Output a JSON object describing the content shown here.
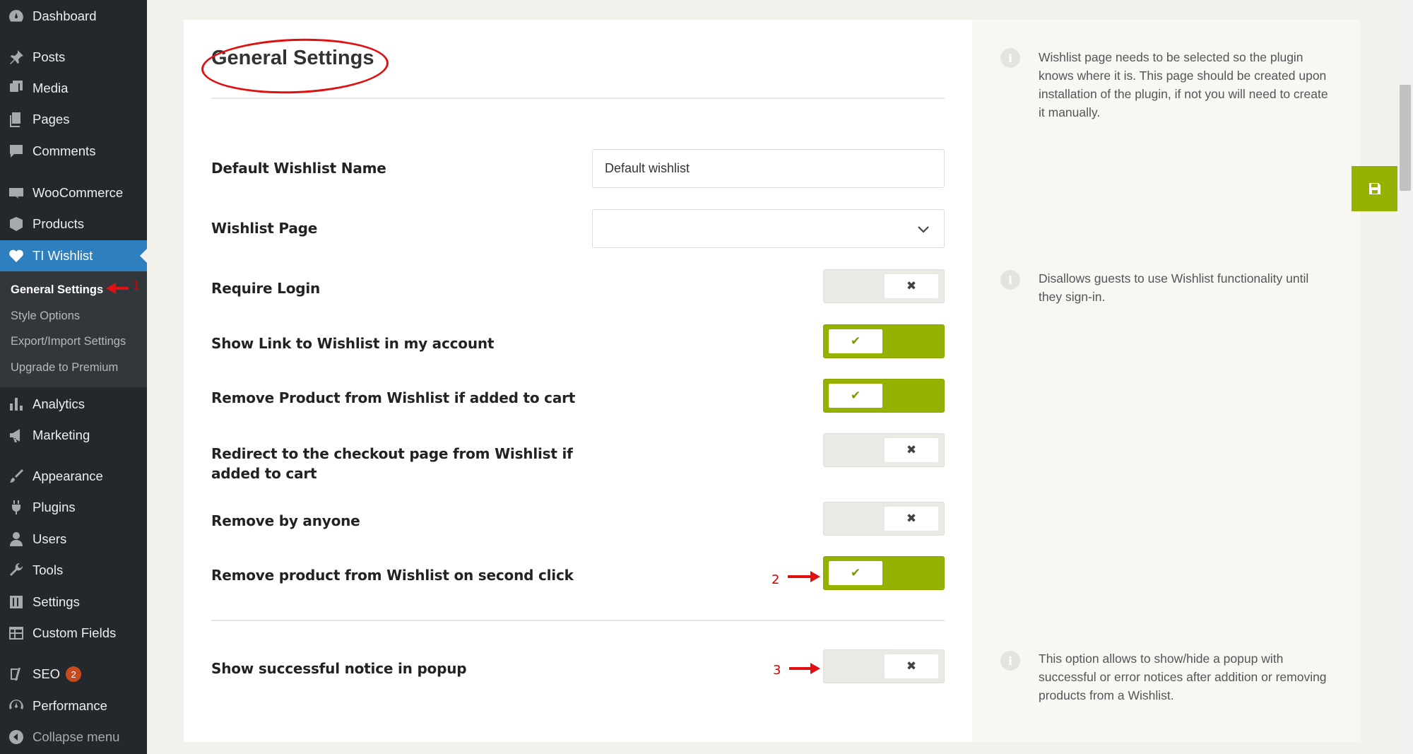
{
  "sidebar": {
    "items": [
      {
        "label": "Dashboard",
        "icon": "dashboard-icon"
      },
      {
        "label": "Posts",
        "icon": "pin-icon"
      },
      {
        "label": "Media",
        "icon": "media-icon"
      },
      {
        "label": "Pages",
        "icon": "pages-icon"
      },
      {
        "label": "Comments",
        "icon": "comment-icon"
      },
      {
        "label": "WooCommerce",
        "icon": "woo-icon"
      },
      {
        "label": "Products",
        "icon": "box-icon"
      },
      {
        "label": "TI Wishlist",
        "icon": "heart-icon"
      },
      {
        "label": "Analytics",
        "icon": "bar-chart-icon"
      },
      {
        "label": "Marketing",
        "icon": "megaphone-icon"
      },
      {
        "label": "Appearance",
        "icon": "brush-icon"
      },
      {
        "label": "Plugins",
        "icon": "plug-icon"
      },
      {
        "label": "Users",
        "icon": "user-icon"
      },
      {
        "label": "Tools",
        "icon": "wrench-icon"
      },
      {
        "label": "Settings",
        "icon": "sliders-icon"
      },
      {
        "label": "Custom Fields",
        "icon": "table-icon"
      },
      {
        "label": "SEO",
        "icon": "yoast-icon",
        "badge": "2"
      },
      {
        "label": "Performance",
        "icon": "gauge-icon"
      },
      {
        "label": "Collapse menu",
        "icon": "collapse-icon"
      }
    ],
    "submenu": [
      "General Settings",
      "Style Options",
      "Export/Import Settings",
      "Upgrade to Premium"
    ]
  },
  "page": {
    "title": "General Settings",
    "fields": {
      "default_wishlist_name": {
        "label": "Default Wishlist Name",
        "value": "Default wishlist"
      },
      "wishlist_page": {
        "label": "Wishlist Page",
        "value": ""
      },
      "require_login": {
        "label": "Require Login",
        "on": false
      },
      "show_link": {
        "label": "Show Link to Wishlist in my account",
        "on": true
      },
      "remove_added": {
        "label": "Remove Product from Wishlist if added to cart",
        "on": true
      },
      "redirect_checkout": {
        "label": "Redirect to the checkout page from Wishlist if added to cart",
        "on": false
      },
      "remove_anyone": {
        "label": "Remove by anyone",
        "on": false
      },
      "remove_second_click": {
        "label": "Remove product from Wishlist on second click",
        "on": true
      },
      "show_notice": {
        "label": "Show successful notice in popup",
        "on": false
      }
    },
    "toggle_symbols": {
      "on": "✔",
      "off": "✖"
    },
    "info": {
      "wishlist_page": "Wishlist page needs to be selected so the plugin knows where it is. This page should be created upon installation of the plugin, if not you will need to create it manually.",
      "require_login": "Disallows guests to use Wishlist functionality until they sign-in.",
      "show_notice": "This option allows to show/hide a popup with successful or error notices after addition or removing products from a Wishlist."
    },
    "info_icon": "i"
  },
  "annotations": {
    "one": "1",
    "two": "2",
    "three": "3"
  },
  "colors": {
    "accent_green": "#96b100",
    "active_blue": "#2e7fbf",
    "annotation_red": "#e01010"
  }
}
